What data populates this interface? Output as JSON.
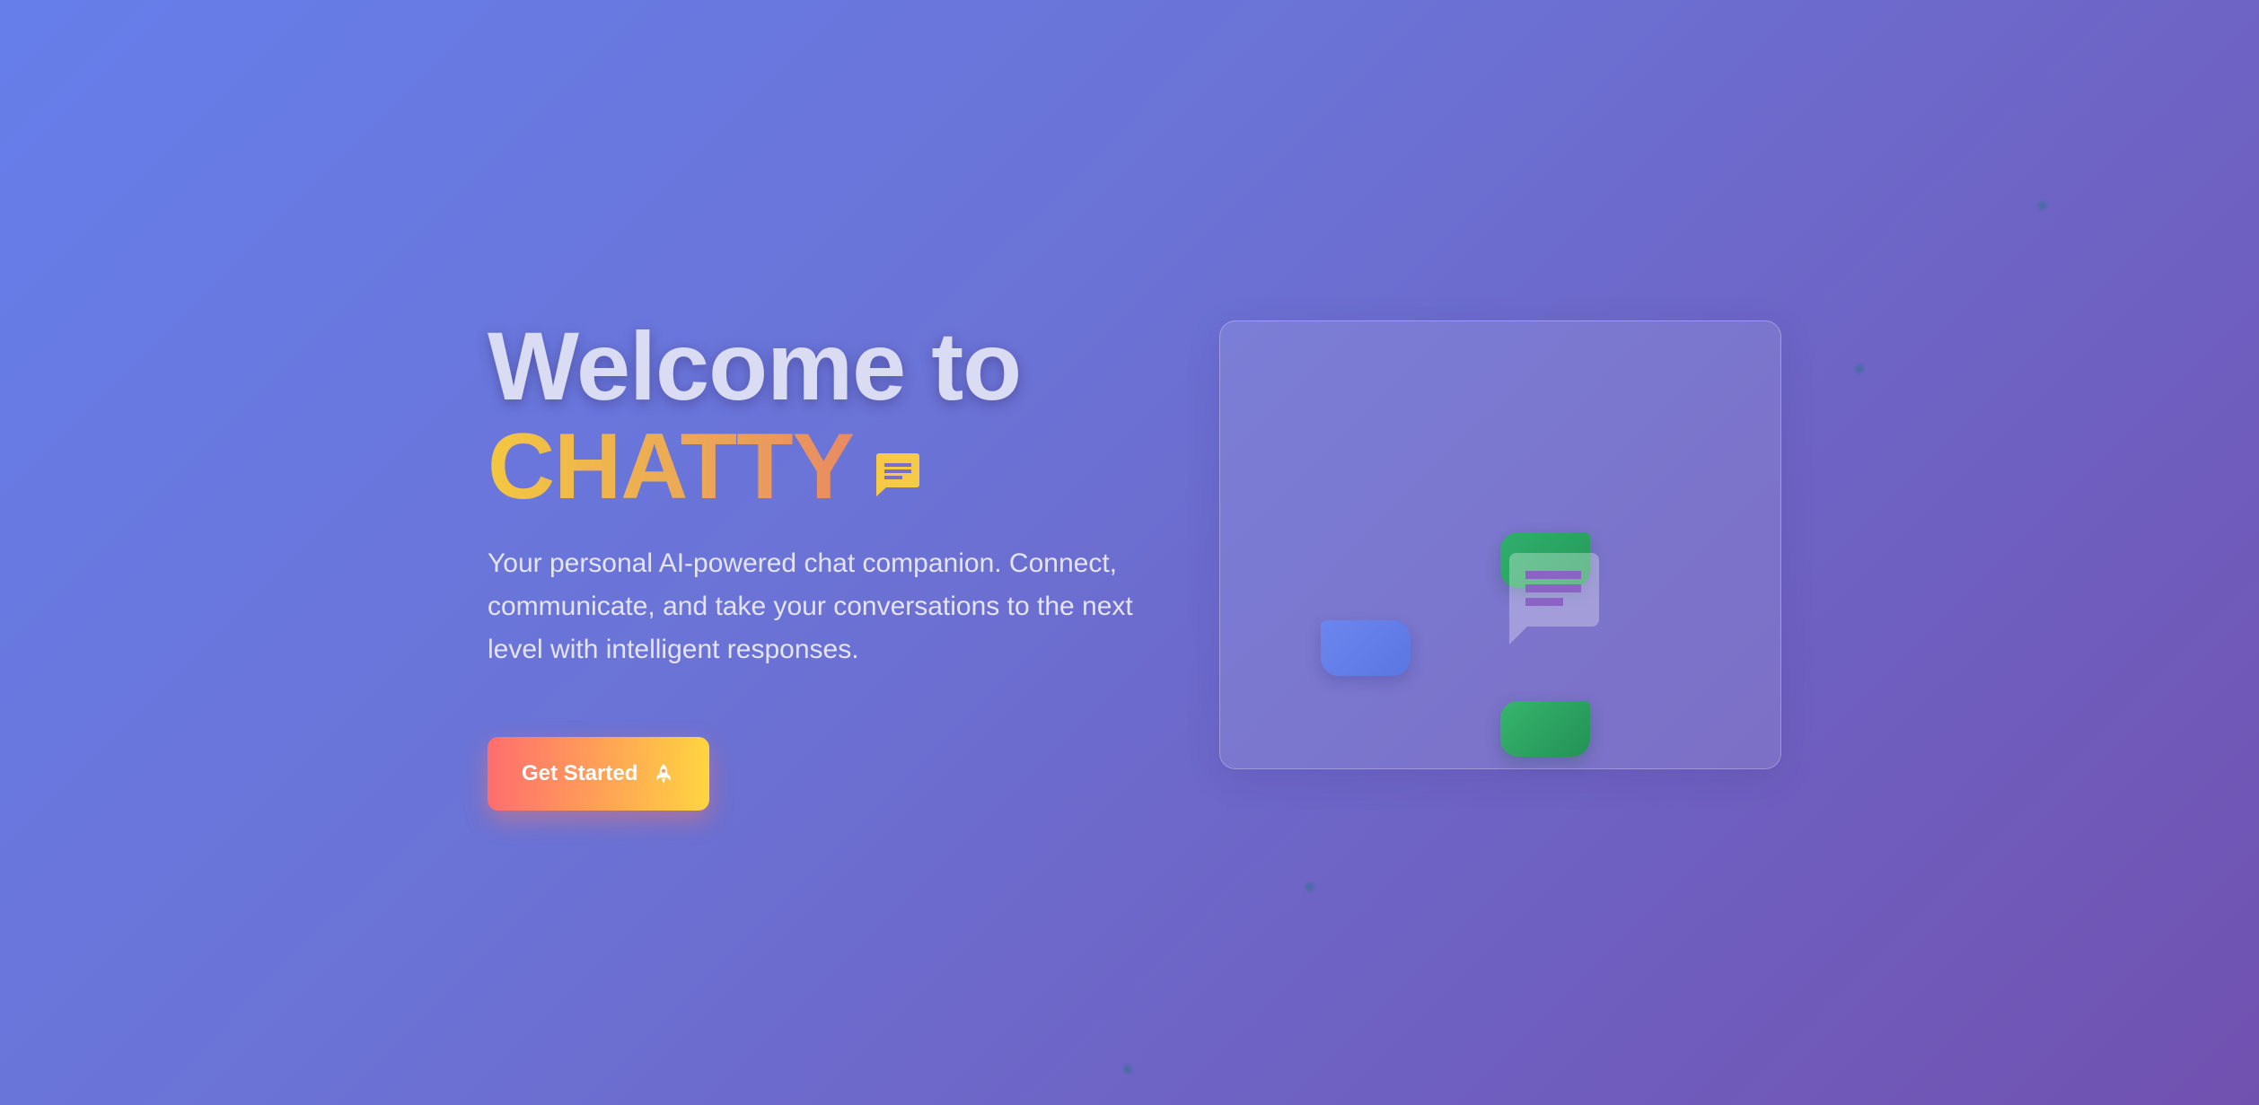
{
  "hero": {
    "title_line1": "Welcome to",
    "brand_name": "CHATTY",
    "brand_icon": "chat-message-icon",
    "tagline": "Your personal AI-powered chat companion. Connect, communicate, and take your conversations to the next level with intelligent responses.",
    "cta_label": "Get Started",
    "cta_icon": "rocket-icon"
  },
  "illustration": {
    "center_icon": "chat-message-icon",
    "bubbles": [
      "outgoing-blue",
      "incoming-green",
      "incoming-green"
    ]
  },
  "colors": {
    "background_start": "#667eea",
    "background_end": "#7151b0",
    "brand_gradient_start": "#f2c740",
    "brand_gradient_end": "#e88a62",
    "cta_gradient_start": "#ff6e6e",
    "cta_gradient_end": "#ffd540",
    "bubble_blue": "#6b86ee",
    "bubble_green": "#2fb06b"
  }
}
